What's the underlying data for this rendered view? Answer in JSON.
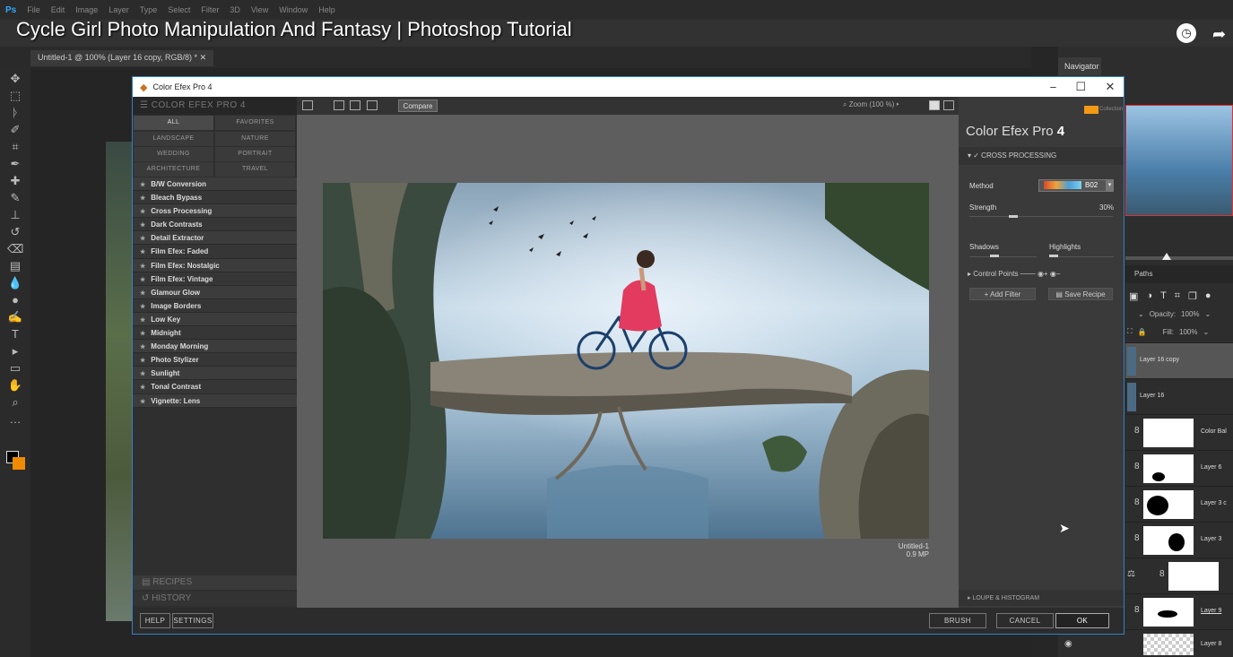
{
  "video_title": "Cycle Girl Photo Manipulation And Fantasy | Photoshop Tutorial",
  "photoshop": {
    "logo": "Ps",
    "menu": [
      "File",
      "Edit",
      "Image",
      "Layer",
      "Type",
      "Select",
      "Filter",
      "3D",
      "View",
      "Window",
      "Help"
    ],
    "doc_tab": "Untitled-1 @ 100% (Layer 16 copy, RGB/8) *",
    "tools": [
      "move-tool-icon",
      "marquee-tool-icon",
      "lasso-tool-icon",
      "quick-select-icon",
      "crop-tool-icon",
      "eyedropper-icon",
      "healing-brush-icon",
      "brush-tool-icon",
      "stamp-tool-icon",
      "history-brush-icon",
      "eraser-icon",
      "gradient-tool-icon",
      "blur-tool-icon",
      "dodge-tool-icon",
      "pen-tool-icon",
      "type-tool-icon",
      "path-select-icon",
      "shape-tool-icon",
      "hand-tool-icon",
      "zoom-tool-icon",
      "more-tools-icon"
    ],
    "tool_glyphs": [
      "✥",
      "⬚",
      "ᚦ",
      "✐",
      "⌗",
      "✒",
      "✚",
      "✎",
      "⊥",
      "↺",
      "⌫",
      "▤",
      "💧",
      "●",
      "✍",
      "T",
      "▸",
      "▭",
      "✋",
      "⌕",
      "…"
    ],
    "foreground_color": "#000000",
    "background_color": "#f08a00",
    "navigator_label": "Navigator",
    "paths_label": "Paths",
    "opacity_label": "Opacity:",
    "opacity_value": "100%",
    "fill_label": "Fill:",
    "fill_value": "100%",
    "layers": [
      {
        "name": "Layer 16 copy",
        "selected": true
      },
      {
        "name": "Layer 16",
        "selected": false
      },
      {
        "name": "Color Bal",
        "selected": false
      },
      {
        "name": "Layer 6",
        "selected": false
      },
      {
        "name": "Layer 3 c",
        "selected": false
      },
      {
        "name": "Layer 3",
        "selected": false
      },
      {
        "name": "",
        "selected": false
      },
      {
        "name": "Layer 9",
        "selected": false
      },
      {
        "name": "Layer 8",
        "selected": false
      }
    ]
  },
  "dialog": {
    "title": "Color Efex Pro 4",
    "win_controls": [
      "−",
      "☐",
      "✕"
    ],
    "left_header": "COLOR EFEX PRO 4",
    "categories": [
      "ALL",
      "FAVORITES",
      "LANDSCAPE",
      "NATURE",
      "WEDDING",
      "PORTRAIT",
      "ARCHITECTURE",
      "TRAVEL"
    ],
    "filters": [
      "B/W Conversion",
      "Bleach Bypass",
      "Cross Processing",
      "Dark Contrasts",
      "Detail Extractor",
      "Film Efex: Faded",
      "Film Efex: Nostalgic",
      "Film Efex: Vintage",
      "Glamour Glow",
      "Image Borders",
      "Low Key",
      "Midnight",
      "Monday Morning",
      "Photo Stylizer",
      "Sunlight",
      "Tonal Contrast",
      "Vignette: Lens"
    ],
    "recipes": "RECIPES",
    "history": "HISTORY",
    "compare": "Compare",
    "zoom": "Zoom (100 %)",
    "doc_name": "Untitled-1",
    "doc_size": "0.9 MP",
    "right_title_light": "Color Efex Pro",
    "right_title_num": "4",
    "nik_label": "Collection",
    "filter_header": "CROSS PROCESSING",
    "method_label": "Method",
    "method_value": "B02",
    "strength_label": "Strength",
    "strength_value": "30%",
    "shadows_label": "Shadows",
    "highlights_label": "Highlights",
    "control_points": "Control Points",
    "add_filter": "Add Filter",
    "save_recipe": "Save Recipe",
    "loupe": "LOUPE & HISTOGRAM",
    "help": "HELP",
    "settings": "SETTINGS",
    "brush": "BRUSH",
    "cancel": "CANCEL",
    "ok": "OK"
  }
}
